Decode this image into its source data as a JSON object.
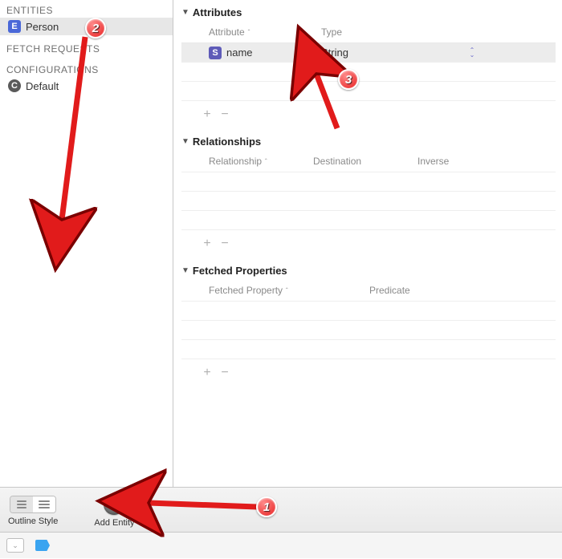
{
  "sidebar": {
    "groups": {
      "entities_label": "ENTITIES",
      "fetch_label": "FETCH REQUESTS",
      "config_label": "CONFIGURATIONS"
    },
    "entity_badge": "E",
    "entity_name": "Person",
    "config_badge": "C",
    "config_name": "Default"
  },
  "sections": {
    "attributes": {
      "title": "Attributes",
      "col_attribute": "Attribute",
      "col_type": "Type",
      "row": {
        "badge": "S",
        "name": "name",
        "type": "String"
      }
    },
    "relationships": {
      "title": "Relationships",
      "col_rel": "Relationship",
      "col_dest": "Destination",
      "col_inv": "Inverse"
    },
    "fetched": {
      "title": "Fetched Properties",
      "col_fp": "Fetched Property",
      "col_pred": "Predicate"
    }
  },
  "toolbar": {
    "outline_label": "Outline Style",
    "add_entity_label": "Add Entity"
  },
  "annotations": {
    "n1": "1",
    "n2": "2",
    "n3": "3"
  },
  "glyphs": {
    "plus": "+",
    "minus": "−",
    "caret_down": "▼",
    "caret_up": "ˆ",
    "sort": "ˆ",
    "updown": "⌃⌄",
    "chev": "⌄"
  }
}
